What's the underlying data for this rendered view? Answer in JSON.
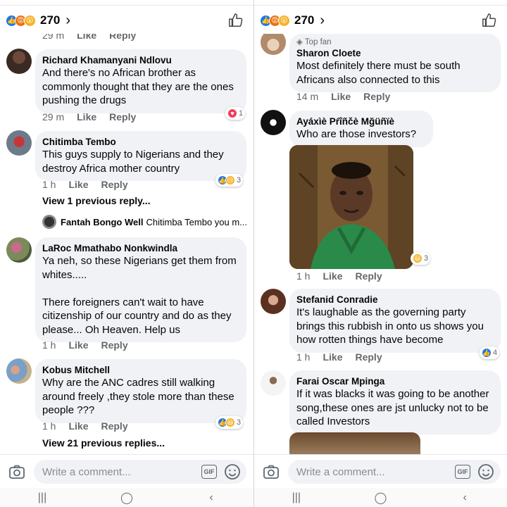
{
  "panels": [
    {
      "header": {
        "count": "270"
      },
      "comment_bar": {
        "placeholder": "Write a comment...",
        "gif_label": "GIF"
      },
      "partial_top": {
        "time": "29 m",
        "like": "Like",
        "reply": "Reply"
      },
      "comments": [
        {
          "name": "Richard Khamanyani Ndlovu",
          "text": "And there's no African brother as commonly thought that they are the ones pushing the drugs",
          "time": "29 m",
          "like": "Like",
          "reply": "Reply",
          "reaction_count": "1"
        },
        {
          "name": "Chitimba Tembo",
          "text": "This guys supply to Nigerians and they destroy Africa mother country",
          "time": "1 h",
          "like": "Like",
          "reply": "Reply",
          "reaction_count": "3",
          "view_replies": "View 1 previous reply...",
          "reply_preview": {
            "name": "Fantah Bongo Well",
            "text": "Chitimba Tembo you m..."
          }
        },
        {
          "name": "LaRoc Mmathabo Nonkwindla",
          "text": "Ya neh, so these Nigerians get them from whites.....\n\nThere foreigners can't wait to have citizenship of our country and do as they please... Oh Heaven. Help us",
          "time": "1 h",
          "like": "Like",
          "reply": "Reply"
        },
        {
          "name": "Kobus Mitchell",
          "text": "Why are the ANC cadres still walking around freely ,they stole more than these people ???",
          "time": "1 h",
          "like": "Like",
          "reply": "Reply",
          "reaction_count": "3",
          "view_replies": "View 21 previous replies..."
        }
      ]
    },
    {
      "header": {
        "count": "270"
      },
      "comment_bar": {
        "placeholder": "Write a comment...",
        "gif_label": "GIF"
      },
      "comments": [
        {
          "badge": "Top fan",
          "name": "Sharon Cloete",
          "text": "Most definitely there must be south Africans also connected to this",
          "time": "14 m",
          "like": "Like",
          "reply": "Reply"
        },
        {
          "name": "Ayáxìè Pŕîñčè Mğüñïè",
          "text": "Who are  those investors?",
          "time": "1 h",
          "like": "Like",
          "reply": "Reply",
          "reaction_count": "3"
        },
        {
          "name": "Stefanid Conradie",
          "text": "It's laughable as the governing party brings this rubbish in onto us shows you how rotten things have become",
          "time": "1 h",
          "like": "Like",
          "reply": "Reply",
          "reaction_count": "4"
        },
        {
          "name": "Farai Oscar Mpinga",
          "text": "If it was blacks it was going to be another song,these ones are jst unlucky not to be called Investors"
        }
      ]
    }
  ],
  "icons": {
    "reaction_like": "thumbs-up",
    "reaction_angry": "angry-face",
    "reaction_wow": "wow-face",
    "header_thumb": "thumbs-up-outline",
    "camera": "camera",
    "emoji": "smiley",
    "gif": "gif"
  },
  "colors": {
    "like_blue": "#1877f2",
    "love_red": "#f33e58",
    "haha_yellow": "#f7b125",
    "angry_orange": "#e9710f",
    "bubble_bg": "#f0f2f5",
    "meta_gray": "#65676b"
  }
}
